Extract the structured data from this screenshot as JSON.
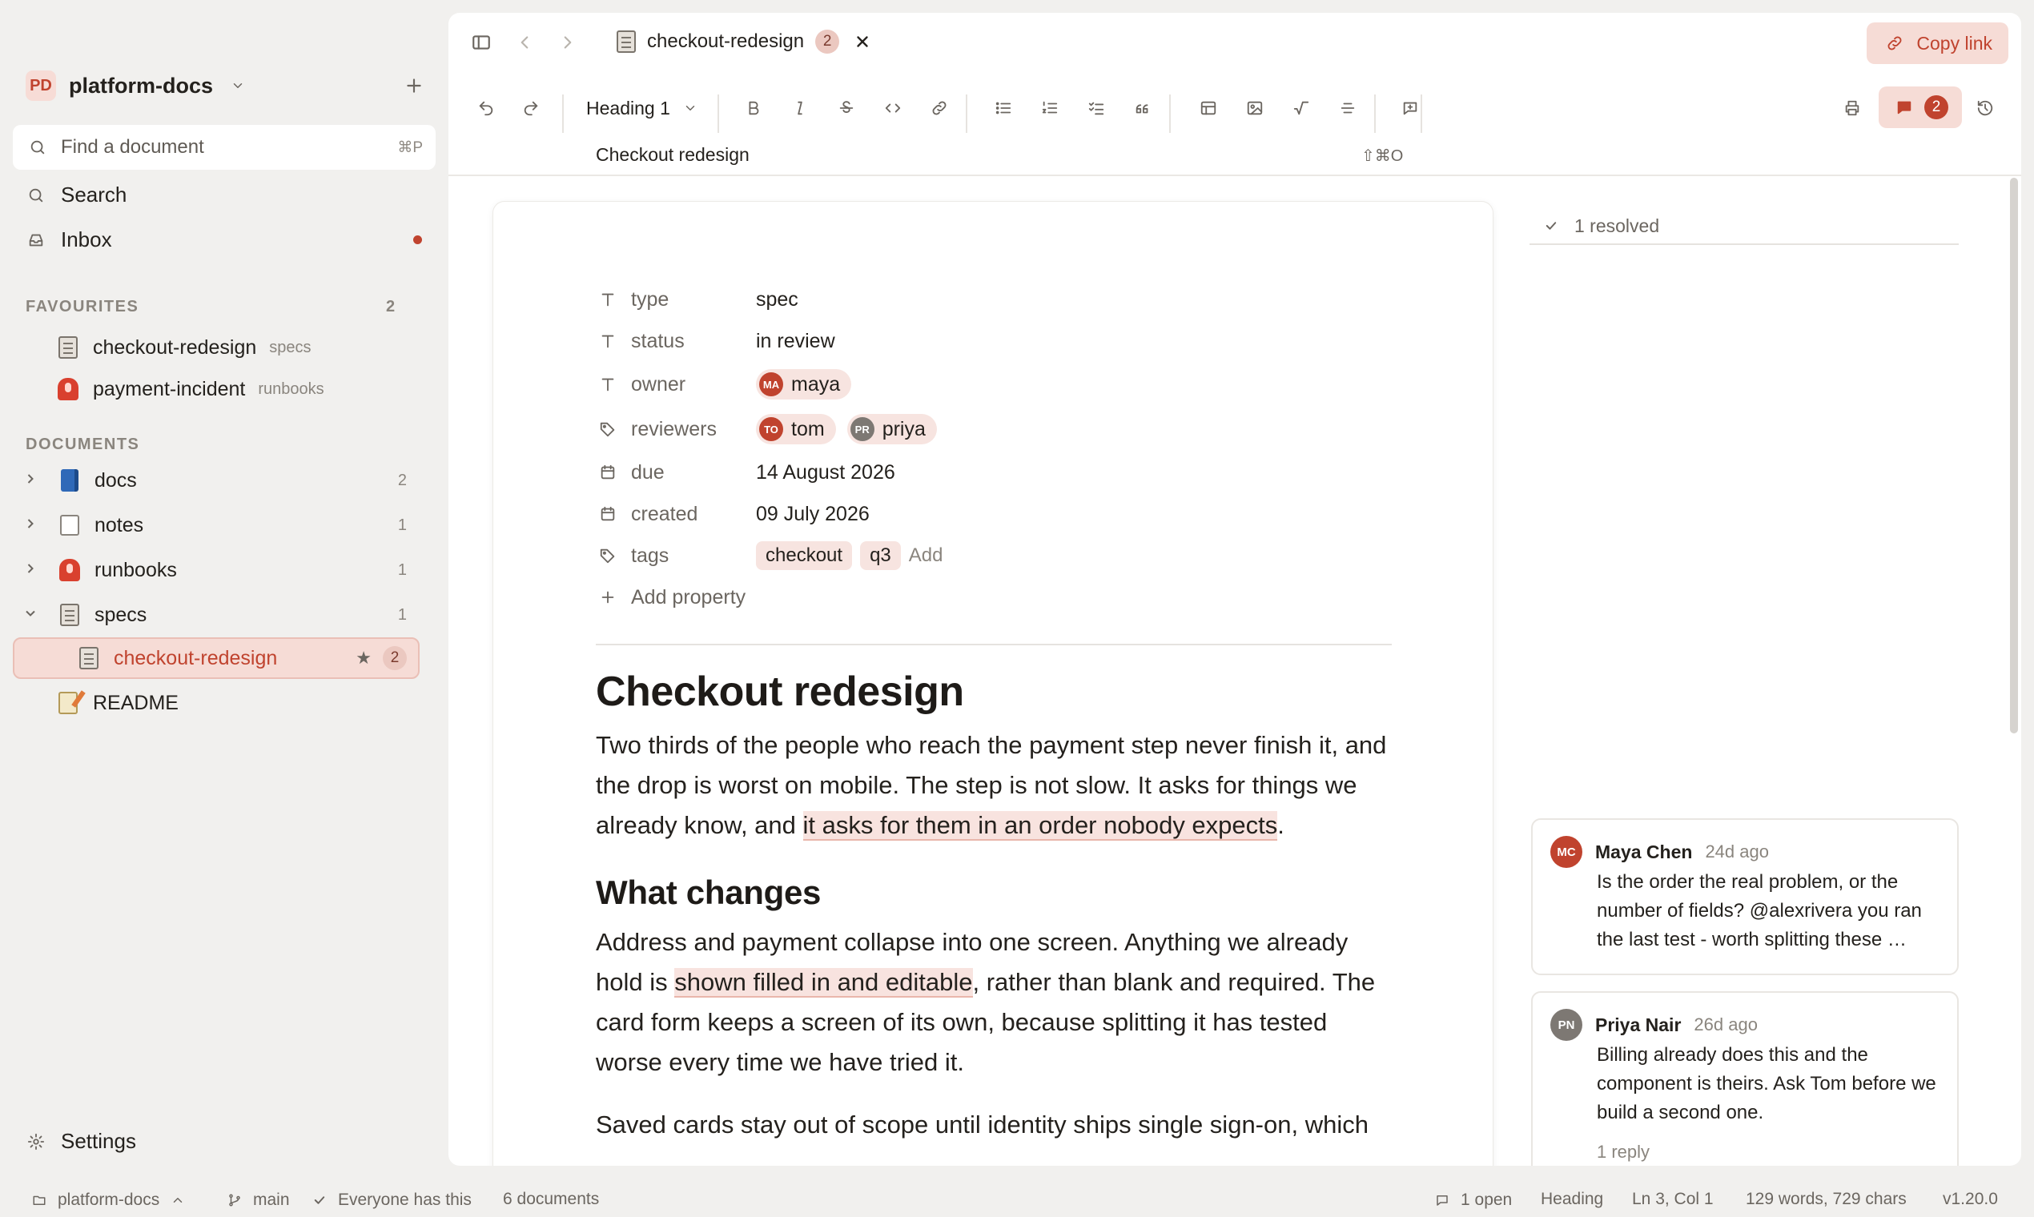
{
  "sidebar": {
    "workspace": {
      "badge": "PD",
      "name": "platform-docs"
    },
    "find": {
      "placeholder": "Find a document",
      "shortcut": "⌘P"
    },
    "nav": [
      {
        "label": "Search"
      },
      {
        "label": "Inbox"
      }
    ],
    "favourites": {
      "title": "FAVOURITES",
      "count": "2",
      "items": [
        {
          "label": "checkout-redesign",
          "sub": "specs"
        },
        {
          "label": "payment-incident",
          "sub": "runbooks"
        }
      ]
    },
    "documents": {
      "title": "DOCUMENTS",
      "items": [
        {
          "label": "docs",
          "count": "2"
        },
        {
          "label": "notes",
          "count": "1"
        },
        {
          "label": "runbooks",
          "count": "1"
        },
        {
          "label": "specs",
          "count": "1"
        },
        {
          "label": "checkout-redesign",
          "count": "2"
        },
        {
          "label": "README"
        }
      ]
    },
    "settings": "Settings"
  },
  "tab": {
    "title": "checkout-redesign",
    "count": "2"
  },
  "copy_link": "Copy link",
  "toolbar": {
    "heading_select": "Heading 1",
    "comments_count": "2"
  },
  "crumb": {
    "title": "Checkout redesign",
    "shortcut": "⇧⌘O"
  },
  "properties": [
    {
      "key": "type",
      "value": "spec"
    },
    {
      "key": "status",
      "value": "in review"
    },
    {
      "key": "owner",
      "people": [
        {
          "initials": "MA",
          "name": "maya"
        }
      ]
    },
    {
      "key": "reviewers",
      "people": [
        {
          "initials": "TO",
          "name": "tom"
        },
        {
          "initials": "PR",
          "name": "priya"
        }
      ]
    },
    {
      "key": "due",
      "value": "14 August 2026"
    },
    {
      "key": "created",
      "value": "09 July 2026"
    },
    {
      "key": "tags",
      "tags": [
        "checkout",
        "q3"
      ],
      "add": "Add"
    }
  ],
  "add_property": "Add property",
  "doc": {
    "h1": "Checkout redesign",
    "p1": {
      "before": "Two thirds of the people who reach the payment step never finish it, and the drop is worst on mobile. The step is not slow. It asks for things we already know, and ",
      "mark": "it asks for them in an order nobody expects",
      "after": "."
    },
    "h2": "What changes",
    "p2": {
      "before": "Address and payment collapse into one screen. Anything we already hold is ",
      "mark": "shown filled in and editable",
      "after": ", rather than blank and required. The card form keeps a screen of its own, because splitting it has tested worse every time we have tried it."
    },
    "p3": "Saved cards stay out of scope until identity ships single sign-on, which"
  },
  "comments": {
    "resolved": "1 resolved",
    "items": [
      {
        "initials": "MC",
        "name": "Maya Chen",
        "ago": "24d ago",
        "text": "Is the order the real problem, or the number of fields? @alexrivera you ran the last test - worth splitting these …",
        "color": "#c0432e"
      },
      {
        "initials": "PN",
        "name": "Priya Nair",
        "ago": "26d ago",
        "text": "Billing already does this and the component is theirs. Ask Tom before we build a second one.",
        "reply": "1 reply",
        "color": "#7d7873"
      }
    ]
  },
  "status": {
    "workspace": "platform-docs",
    "branch": "main",
    "share": "Everyone has this",
    "docs": "6 documents",
    "open": "1 open",
    "block": "Heading",
    "cursor": "Ln 3, Col 1",
    "counts": "129 words, 729 chars",
    "version": "v1.20.0"
  },
  "colors": {
    "accent": "#c0432e",
    "accent_bg": "#f6dcd6",
    "sidebar_bg": "#f1f0ee"
  }
}
